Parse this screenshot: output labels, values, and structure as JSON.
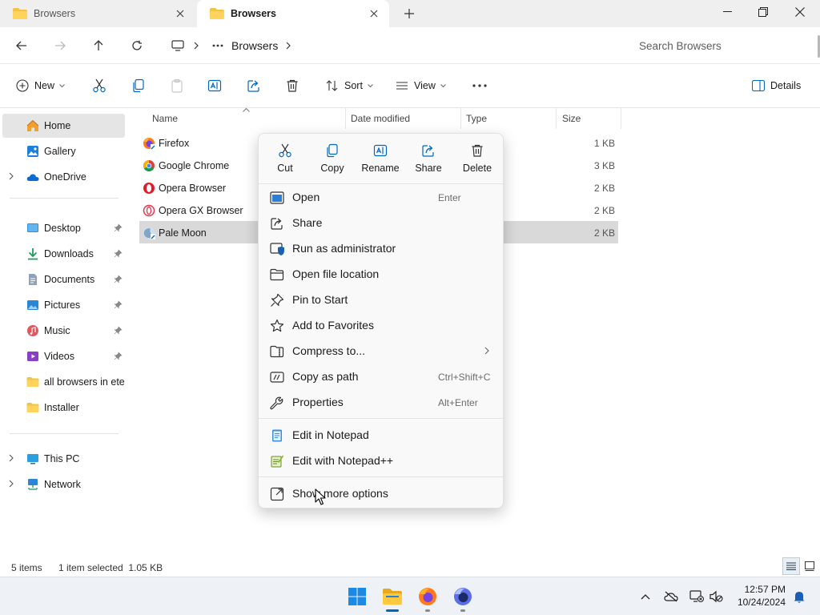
{
  "tabs": [
    {
      "label": "Browsers",
      "active": false
    },
    {
      "label": "Browsers",
      "active": true
    }
  ],
  "address": {
    "path_label": "Browsers",
    "search_placeholder": "Search Browsers"
  },
  "commandbar": {
    "new_label": "New",
    "sort_label": "Sort",
    "view_label": "View",
    "details_label": "Details"
  },
  "nav": {
    "items": [
      {
        "label": "Home",
        "icon": "home-icon"
      },
      {
        "label": "Gallery",
        "icon": "gallery-icon"
      },
      {
        "label": "OneDrive",
        "icon": "onedrive-icon"
      },
      {
        "label": "Desktop",
        "icon": "desktop-icon"
      },
      {
        "label": "Downloads",
        "icon": "downloads-icon"
      },
      {
        "label": "Documents",
        "icon": "documents-icon"
      },
      {
        "label": "Pictures",
        "icon": "pictures-icon"
      },
      {
        "label": "Music",
        "icon": "music-icon"
      },
      {
        "label": "Videos",
        "icon": "videos-icon"
      },
      {
        "label": "all browsers in eter",
        "icon": "folder-icon"
      },
      {
        "label": "Installer",
        "icon": "folder-icon"
      },
      {
        "label": "This PC",
        "icon": "this-pc-icon"
      },
      {
        "label": "Network",
        "icon": "network-icon"
      }
    ]
  },
  "filelist": {
    "columns": [
      "Name",
      "Date modified",
      "Type",
      "Size"
    ],
    "rows": [
      {
        "name": "Firefox",
        "size": "1 KB",
        "selected": false
      },
      {
        "name": "Google Chrome",
        "size": "3 KB",
        "selected": false
      },
      {
        "name": "Opera Browser",
        "size": "2 KB",
        "selected": false
      },
      {
        "name": "Opera GX Browser",
        "size": "2 KB",
        "selected": false
      },
      {
        "name": "Pale Moon",
        "size": "2 KB",
        "selected": true
      }
    ]
  },
  "context_menu": {
    "quick_actions": [
      {
        "label": "Cut",
        "icon": "cut-icon"
      },
      {
        "label": "Copy",
        "icon": "copy-icon"
      },
      {
        "label": "Rename",
        "icon": "rename-icon"
      },
      {
        "label": "Share",
        "icon": "share-icon"
      },
      {
        "label": "Delete",
        "icon": "delete-icon"
      }
    ],
    "items": [
      {
        "label": "Open",
        "shortcut": "Enter"
      },
      {
        "label": "Share",
        "shortcut": ""
      },
      {
        "label": "Run as administrator",
        "shortcut": ""
      },
      {
        "label": "Open file location",
        "shortcut": ""
      },
      {
        "label": "Pin to Start",
        "shortcut": ""
      },
      {
        "label": "Add to Favorites",
        "shortcut": ""
      },
      {
        "label": "Compress to...",
        "shortcut": ""
      },
      {
        "label": "Copy as path",
        "shortcut": "Ctrl+Shift+C"
      },
      {
        "label": "Properties",
        "shortcut": "Alt+Enter"
      },
      {
        "label": "Edit in Notepad",
        "shortcut": ""
      },
      {
        "label": "Edit with Notepad++",
        "shortcut": ""
      },
      {
        "label": "Show more options",
        "shortcut": ""
      }
    ]
  },
  "status": {
    "item_count": "5 items",
    "selection": "1 item selected  1.05 KB"
  },
  "taskbar": {
    "time": "12:57 PM",
    "date": "10/24/2024"
  },
  "colors": {
    "accent": "#0067c0",
    "folder": "#f4c247",
    "selection": "#d9d9d9"
  }
}
